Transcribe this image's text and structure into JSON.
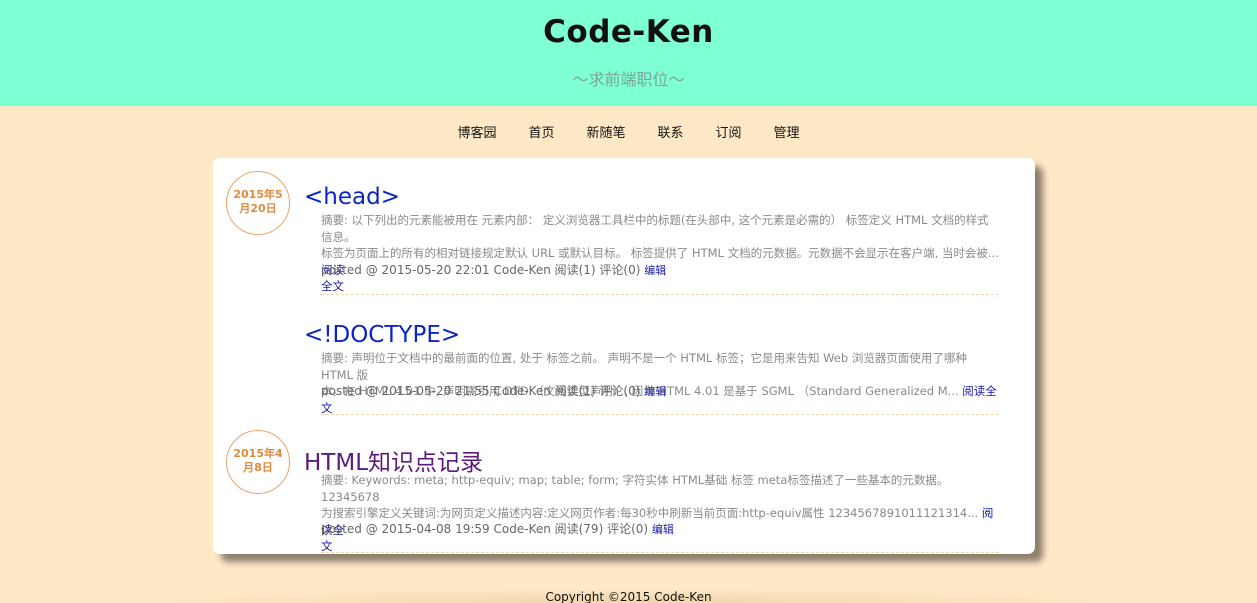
{
  "header": {
    "title": "Code-Ken",
    "subtitle": "〜求前端职位〜"
  },
  "nav": [
    "博客园",
    "首页",
    "新随笔",
    "联系",
    "订阅",
    "管理"
  ],
  "posts": [
    {
      "date": "2015年5月20日",
      "date_line1": "2015年5",
      "date_line2": "月20日",
      "title": "<head>",
      "summary_l1": "摘要: 以下列出的元素能被用在 元素内部： 定义浏览器工具栏中的标题(在头部中, 这个元素是必需的） 标签定义 HTML 文档的样式信息。",
      "summary_l2": "标签为页面上的所有的相对链接规定默认 URL 或默认目标。 标签提供了 HTML 文档的元数据。元数据不会显示在客户端, 当时会被...",
      "read_more_a": "阅读",
      "read_more_b": "全文",
      "meta": "posted @ 2015-05-20 22:01 Code-Ken 阅读(1) 评论(0)",
      "edit": "编辑"
    },
    {
      "title": "<!DOCTYPE>",
      "summary_l1": "摘要: 声明位于文档中的最前面的位置, 处于 标签之前。 声明不是一个 HTML 标签；它是用来告知 Web 浏览器页面使用了哪种 HTML 版",
      "summary_l2": "本。在 HTML 4.01 中, 声明需引用 DTD （文档类型声明）, 因为 HTML 4.01 是基于 SGML （Standard Generalized M...",
      "read_more": "阅读全文",
      "meta": "posted @ 2015-05-20 21:55 Code-Ken 阅读(1) 评论(0)",
      "edit": "编辑"
    },
    {
      "date": "2015年4月8日",
      "date_line1": "2015年4",
      "date_line2": "月8日",
      "title": "HTML知识点记录",
      "summary_l1": "摘要: Keywords: meta; http-equiv; map; table; form; 字符实体 HTML基础 标签 meta标签描述了一些基本的元数据。 12345678",
      "summary_l2": "为搜索引擎定义关键词:为网页定义描述内容:定义网页作者:每30秒中刷新当前页面:http-equiv属性 1234567891011121314...",
      "read_more_a": "阅读全",
      "read_more_b": "文",
      "meta": "posted @ 2015-04-08 19:59 Code-Ken 阅读(79) 评论(0)",
      "edit": "编辑"
    }
  ],
  "footer": "Copyright ©2015 Code-Ken",
  "colors": {
    "header_bg": "#7fffd4",
    "page_bg": "#ffe8c6",
    "date_accent": "#e08a3e",
    "link_blue": "#0b23c8",
    "visited_purple": "#5a1a7e"
  }
}
